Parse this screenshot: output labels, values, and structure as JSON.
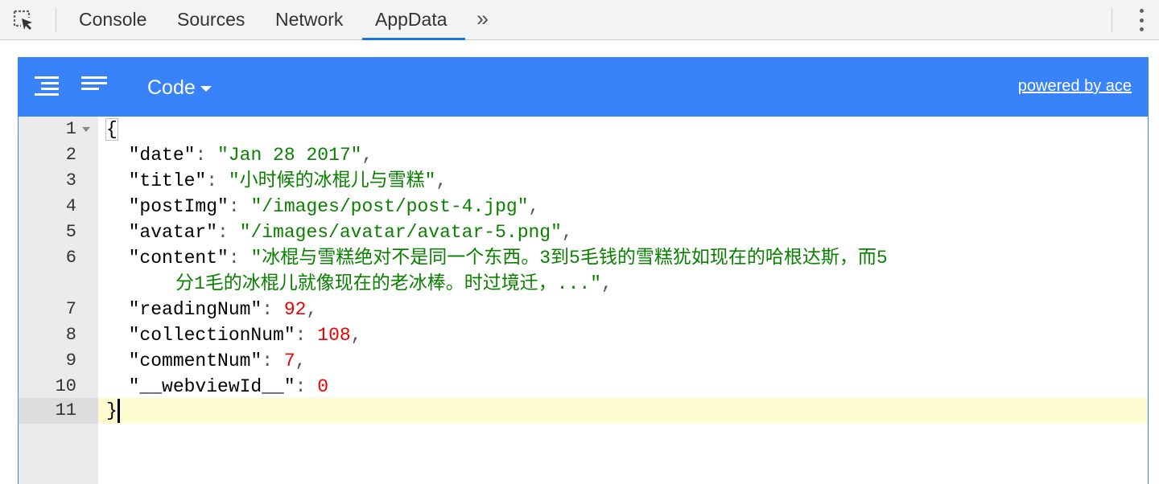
{
  "toolbar": {
    "inspect_icon": "inspect-element-icon",
    "tabs": [
      {
        "label": "Console",
        "active": false
      },
      {
        "label": "Sources",
        "active": false
      },
      {
        "label": "Network",
        "active": false
      },
      {
        "label": "AppData",
        "active": true
      }
    ],
    "more_label": "»",
    "menu_icon": "vertical-dots-icon"
  },
  "editor": {
    "mode_label": "Code",
    "powered_label": "powered by ace",
    "accent_color": "#3883fa",
    "lines": {
      "l1": "{",
      "l2_key": "\"date\"",
      "l2_val": "\"Jan 28 2017\"",
      "l3_key": "\"title\"",
      "l3_val": "\"小时候的冰棍儿与雪糕\"",
      "l4_key": "\"postImg\"",
      "l4_val": "\"/images/post/post-4.jpg\"",
      "l5_key": "\"avatar\"",
      "l5_val": "\"/images/avatar/avatar-5.png\"",
      "l6_key": "\"content\"",
      "l6_val_a": "\"冰棍与雪糕绝对不是同一个东西。3到5毛钱的雪糕犹如现在的哈根达斯，而5",
      "l6_val_b": "分1毛的冰棍儿就像现在的老冰棒。时过境迁，...\"",
      "l7_key": "\"readingNum\"",
      "l7_val": "92",
      "l8_key": "\"collectionNum\"",
      "l8_val": "108",
      "l9_key": "\"commentNum\"",
      "l9_val": "7",
      "l10_key": "\"__webviewId__\"",
      "l10_val": "0",
      "l11": "}"
    },
    "line_numbers": [
      "1",
      "2",
      "3",
      "4",
      "5",
      "6",
      "7",
      "8",
      "9",
      "10",
      "11"
    ]
  }
}
